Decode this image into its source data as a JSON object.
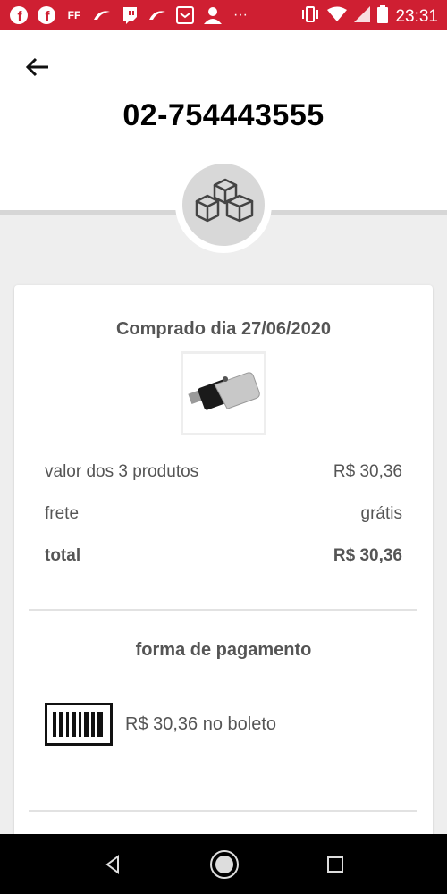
{
  "status_bar": {
    "time": "23:31",
    "color": "#cf1f32",
    "icons": [
      "facebook-icon",
      "facebook-icon",
      "ff-icon",
      "swirl-icon",
      "twitch-icon",
      "swirl-icon",
      "inbox-icon",
      "person-icon",
      "more-icon",
      "vibrate-icon",
      "wifi-icon",
      "signal-icon",
      "battery-icon"
    ],
    "ff_text": "FF",
    "more_text": "···"
  },
  "header": {
    "order_number": "02-754443555"
  },
  "order": {
    "purchase_date": "Comprado dia 27/06/2020",
    "rows": [
      {
        "label": "valor dos 3 produtos",
        "value": "R$ 30,36"
      },
      {
        "label": "frete",
        "value": "grátis"
      },
      {
        "label": "total",
        "value": "R$ 30,36"
      }
    ]
  },
  "payment": {
    "title": "forma de pagamento",
    "text": "R$ 30,36 no boleto"
  }
}
